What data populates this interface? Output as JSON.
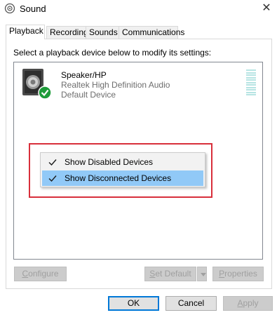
{
  "window": {
    "title": "Sound",
    "close_glyph": "✕",
    "icon": "sound-icon"
  },
  "tabs": [
    {
      "label": "Playback",
      "active": true
    },
    {
      "label": "Recording",
      "active": false
    },
    {
      "label": "Sounds",
      "active": false
    },
    {
      "label": "Communications",
      "active": false
    }
  ],
  "instruction": "Select a playback device below to modify its settings:",
  "device": {
    "name": "Speaker/HP",
    "driver": "Realtek High Definition Audio",
    "status": "Default Device",
    "icon": "speaker-icon",
    "badge": "green-check-icon"
  },
  "context_menu": {
    "items": [
      {
        "label": "Show Disabled Devices",
        "checked": true,
        "highlighted": false
      },
      {
        "label": "Show Disconnected Devices",
        "checked": true,
        "highlighted": true
      }
    ]
  },
  "panel_buttons": {
    "configure": {
      "accel": "C",
      "rest": "onfigure",
      "enabled": false
    },
    "set_default": {
      "accel": "S",
      "rest": "et Default",
      "enabled": false
    },
    "properties": {
      "accel": "P",
      "rest": "roperties",
      "enabled": false
    }
  },
  "footer_buttons": {
    "ok": "OK",
    "cancel": "Cancel",
    "apply": {
      "accel": "A",
      "rest": "pply",
      "enabled": false
    }
  },
  "colors": {
    "highlight_border": "#d82f3b",
    "menu_highlight": "#91c9f7",
    "check_badge": "#1e9c3a",
    "level_meter": "#b6e4e3"
  }
}
